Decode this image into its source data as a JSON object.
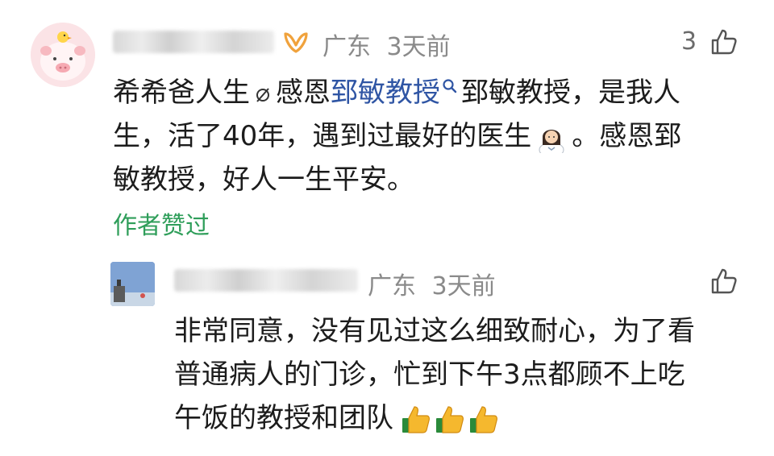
{
  "comment": {
    "location": "广东",
    "time_ago": "3天前",
    "like_count": "3",
    "lines": {
      "l1_a": "希希爸人生",
      "l1_b": "感恩",
      "l1_link": "郅敏教授",
      "l1_c": "郅敏教授，是我人",
      "l2_a": "生，活了40年，遇到过最好的医生",
      "l2_b": "。感恩郅",
      "l3": "敏教授，好人一生平安。"
    },
    "author_liked": "作者赞过"
  },
  "reply": {
    "location": "广东",
    "time_ago": "3天前",
    "lines": {
      "l1": "非常同意，没有见过这么细致耐心，为了看",
      "l2": "普通病人的门诊，忙到下午3点都顾不上吃",
      "l3": "午饭的教授和团队"
    }
  },
  "colors": {
    "link": "#2f55a4",
    "author_liked": "#2f9e5a",
    "badge": "#f0a23c",
    "meta": "#8a8a8a"
  },
  "icons": {
    "badge": "orange-ribbon-badge-icon",
    "like": "thumbs-up-outline-icon",
    "search": "search-icon",
    "empty_set": "empty-set-icon",
    "doctor": "woman-doctor-emoji-icon",
    "thumbs_up_emoji": "thumbs-up-emoji-icon"
  }
}
